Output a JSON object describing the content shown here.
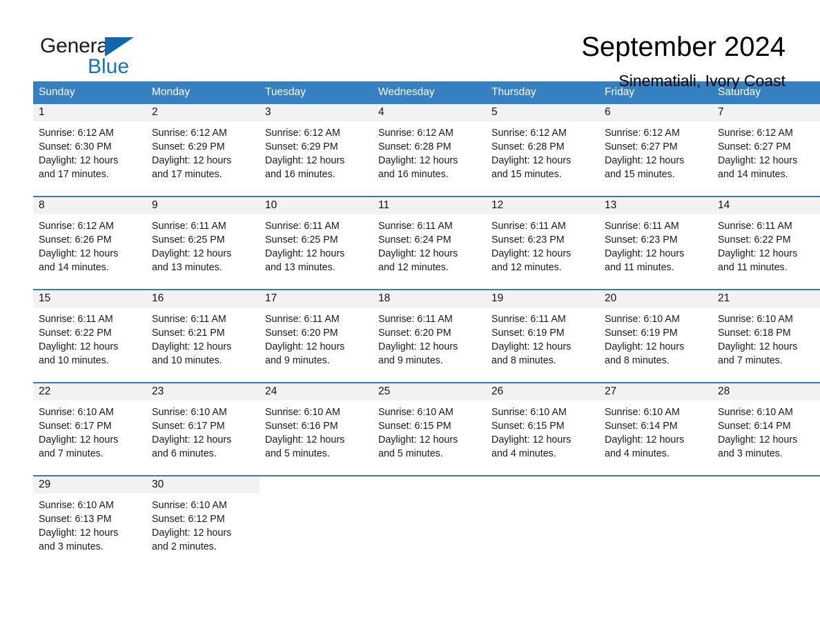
{
  "brand": {
    "name_part1": "General",
    "name_part2": "Blue",
    "triangle_icon": "blue-triangle-logo-mark",
    "colors": {
      "blue": "#1273c4",
      "dark_blue": "#1067ad",
      "black": "#1a1a1a"
    }
  },
  "header": {
    "title": "September 2024",
    "subtitle": "Sinematiali, Ivory Coast"
  },
  "theme": {
    "header_blue": "#3580c0",
    "row_divider_blue": "#2f7ab9",
    "daynum_band_gray": "#f2f2f2",
    "cell_white": "#ffffff"
  },
  "weekdays": [
    "Sunday",
    "Monday",
    "Tuesday",
    "Wednesday",
    "Thursday",
    "Friday",
    "Saturday"
  ],
  "labels": {
    "sunrise_prefix": "Sunrise:",
    "sunset_prefix": "Sunset:",
    "daylight_prefix": "Daylight:"
  },
  "weeks": [
    [
      {
        "day": "1",
        "line1": "Sunrise: 6:12 AM",
        "line2": "Sunset: 6:30 PM",
        "line3": "Daylight: 12 hours",
        "line4": "and 17 minutes."
      },
      {
        "day": "2",
        "line1": "Sunrise: 6:12 AM",
        "line2": "Sunset: 6:29 PM",
        "line3": "Daylight: 12 hours",
        "line4": "and 17 minutes."
      },
      {
        "day": "3",
        "line1": "Sunrise: 6:12 AM",
        "line2": "Sunset: 6:29 PM",
        "line3": "Daylight: 12 hours",
        "line4": "and 16 minutes."
      },
      {
        "day": "4",
        "line1": "Sunrise: 6:12 AM",
        "line2": "Sunset: 6:28 PM",
        "line3": "Daylight: 12 hours",
        "line4": "and 16 minutes."
      },
      {
        "day": "5",
        "line1": "Sunrise: 6:12 AM",
        "line2": "Sunset: 6:28 PM",
        "line3": "Daylight: 12 hours",
        "line4": "and 15 minutes."
      },
      {
        "day": "6",
        "line1": "Sunrise: 6:12 AM",
        "line2": "Sunset: 6:27 PM",
        "line3": "Daylight: 12 hours",
        "line4": "and 15 minutes."
      },
      {
        "day": "7",
        "line1": "Sunrise: 6:12 AM",
        "line2": "Sunset: 6:27 PM",
        "line3": "Daylight: 12 hours",
        "line4": "and 14 minutes."
      }
    ],
    [
      {
        "day": "8",
        "line1": "Sunrise: 6:12 AM",
        "line2": "Sunset: 6:26 PM",
        "line3": "Daylight: 12 hours",
        "line4": "and 14 minutes."
      },
      {
        "day": "9",
        "line1": "Sunrise: 6:11 AM",
        "line2": "Sunset: 6:25 PM",
        "line3": "Daylight: 12 hours",
        "line4": "and 13 minutes."
      },
      {
        "day": "10",
        "line1": "Sunrise: 6:11 AM",
        "line2": "Sunset: 6:25 PM",
        "line3": "Daylight: 12 hours",
        "line4": "and 13 minutes."
      },
      {
        "day": "11",
        "line1": "Sunrise: 6:11 AM",
        "line2": "Sunset: 6:24 PM",
        "line3": "Daylight: 12 hours",
        "line4": "and 12 minutes."
      },
      {
        "day": "12",
        "line1": "Sunrise: 6:11 AM",
        "line2": "Sunset: 6:23 PM",
        "line3": "Daylight: 12 hours",
        "line4": "and 12 minutes."
      },
      {
        "day": "13",
        "line1": "Sunrise: 6:11 AM",
        "line2": "Sunset: 6:23 PM",
        "line3": "Daylight: 12 hours",
        "line4": "and 11 minutes."
      },
      {
        "day": "14",
        "line1": "Sunrise: 6:11 AM",
        "line2": "Sunset: 6:22 PM",
        "line3": "Daylight: 12 hours",
        "line4": "and 11 minutes."
      }
    ],
    [
      {
        "day": "15",
        "line1": "Sunrise: 6:11 AM",
        "line2": "Sunset: 6:22 PM",
        "line3": "Daylight: 12 hours",
        "line4": "and 10 minutes."
      },
      {
        "day": "16",
        "line1": "Sunrise: 6:11 AM",
        "line2": "Sunset: 6:21 PM",
        "line3": "Daylight: 12 hours",
        "line4": "and 10 minutes."
      },
      {
        "day": "17",
        "line1": "Sunrise: 6:11 AM",
        "line2": "Sunset: 6:20 PM",
        "line3": "Daylight: 12 hours",
        "line4": "and 9 minutes."
      },
      {
        "day": "18",
        "line1": "Sunrise: 6:11 AM",
        "line2": "Sunset: 6:20 PM",
        "line3": "Daylight: 12 hours",
        "line4": "and 9 minutes."
      },
      {
        "day": "19",
        "line1": "Sunrise: 6:11 AM",
        "line2": "Sunset: 6:19 PM",
        "line3": "Daylight: 12 hours",
        "line4": "and 8 minutes."
      },
      {
        "day": "20",
        "line1": "Sunrise: 6:10 AM",
        "line2": "Sunset: 6:19 PM",
        "line3": "Daylight: 12 hours",
        "line4": "and 8 minutes."
      },
      {
        "day": "21",
        "line1": "Sunrise: 6:10 AM",
        "line2": "Sunset: 6:18 PM",
        "line3": "Daylight: 12 hours",
        "line4": "and 7 minutes."
      }
    ],
    [
      {
        "day": "22",
        "line1": "Sunrise: 6:10 AM",
        "line2": "Sunset: 6:17 PM",
        "line3": "Daylight: 12 hours",
        "line4": "and 7 minutes."
      },
      {
        "day": "23",
        "line1": "Sunrise: 6:10 AM",
        "line2": "Sunset: 6:17 PM",
        "line3": "Daylight: 12 hours",
        "line4": "and 6 minutes."
      },
      {
        "day": "24",
        "line1": "Sunrise: 6:10 AM",
        "line2": "Sunset: 6:16 PM",
        "line3": "Daylight: 12 hours",
        "line4": "and 5 minutes."
      },
      {
        "day": "25",
        "line1": "Sunrise: 6:10 AM",
        "line2": "Sunset: 6:15 PM",
        "line3": "Daylight: 12 hours",
        "line4": "and 5 minutes."
      },
      {
        "day": "26",
        "line1": "Sunrise: 6:10 AM",
        "line2": "Sunset: 6:15 PM",
        "line3": "Daylight: 12 hours",
        "line4": "and 4 minutes."
      },
      {
        "day": "27",
        "line1": "Sunrise: 6:10 AM",
        "line2": "Sunset: 6:14 PM",
        "line3": "Daylight: 12 hours",
        "line4": "and 4 minutes."
      },
      {
        "day": "28",
        "line1": "Sunrise: 6:10 AM",
        "line2": "Sunset: 6:14 PM",
        "line3": "Daylight: 12 hours",
        "line4": "and 3 minutes."
      }
    ],
    [
      {
        "day": "29",
        "line1": "Sunrise: 6:10 AM",
        "line2": "Sunset: 6:13 PM",
        "line3": "Daylight: 12 hours",
        "line4": "and 3 minutes."
      },
      {
        "day": "30",
        "line1": "Sunrise: 6:10 AM",
        "line2": "Sunset: 6:12 PM",
        "line3": "Daylight: 12 hours",
        "line4": "and 2 minutes."
      },
      {
        "day": "",
        "line1": "",
        "line2": "",
        "line3": "",
        "line4": ""
      },
      {
        "day": "",
        "line1": "",
        "line2": "",
        "line3": "",
        "line4": ""
      },
      {
        "day": "",
        "line1": "",
        "line2": "",
        "line3": "",
        "line4": ""
      },
      {
        "day": "",
        "line1": "",
        "line2": "",
        "line3": "",
        "line4": ""
      },
      {
        "day": "",
        "line1": "",
        "line2": "",
        "line3": "",
        "line4": ""
      }
    ]
  ]
}
